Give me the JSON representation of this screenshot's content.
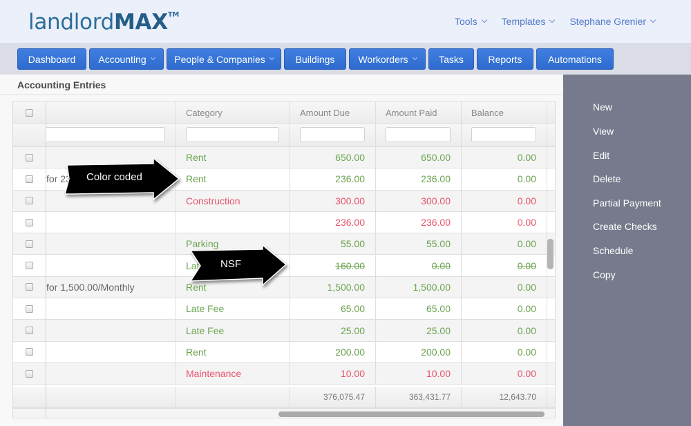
{
  "app": {
    "logo_light": "landlord",
    "logo_bold": "MAX",
    "logo_tm": "TM"
  },
  "topmenu": [
    {
      "label": "Tools"
    },
    {
      "label": "Templates"
    },
    {
      "label": "Stephane Grenier"
    }
  ],
  "nav": [
    {
      "label": "Dashboard",
      "dropdown": false
    },
    {
      "label": "Accounting",
      "dropdown": true
    },
    {
      "label": "People & Companies",
      "dropdown": true
    },
    {
      "label": "Buildings",
      "dropdown": false
    },
    {
      "label": "Workorders",
      "dropdown": true
    },
    {
      "label": "Tasks",
      "dropdown": false
    },
    {
      "label": "Reports",
      "dropdown": false
    },
    {
      "label": "Automations",
      "dropdown": false
    }
  ],
  "section": {
    "title": "Accounting Entries"
  },
  "grid": {
    "columns": [
      "",
      "Category",
      "Amount Due",
      "Amount Paid",
      "Balance"
    ],
    "filters": {
      "description": "",
      "category": "",
      "amount_due": "",
      "amount_paid": "",
      "balance": ""
    },
    "rows": [
      {
        "description": "",
        "category": "Rent",
        "due": "650.00",
        "paid": "650.00",
        "balance": "0.00",
        "color": "green",
        "strike": false
      },
      {
        "description": "for 236.",
        "category": "Rent",
        "due": "236.00",
        "paid": "236.00",
        "balance": "0.00",
        "color": "green",
        "strike": false
      },
      {
        "description": "",
        "category": "Construction",
        "due": "300.00",
        "paid": "300.00",
        "balance": "0.00",
        "color": "red",
        "strike": false
      },
      {
        "description": "",
        "category": "",
        "due": "236.00",
        "paid": "236.00",
        "balance": "0.00",
        "color": "red",
        "strike": false
      },
      {
        "description": "",
        "category": "Parking",
        "due": "55.00",
        "paid": "55.00",
        "balance": "0.00",
        "color": "green",
        "strike": false
      },
      {
        "description": "",
        "category": "Late Fee",
        "due": "160.00",
        "paid": "0.00",
        "balance": "0.00",
        "color": "green",
        "strike": true
      },
      {
        "description": "for 1,500.00/Monthly",
        "category": "Rent",
        "due": "1,500.00",
        "paid": "1,500.00",
        "balance": "0.00",
        "color": "green",
        "strike": false
      },
      {
        "description": "",
        "category": "Late Fee",
        "due": "65.00",
        "paid": "65.00",
        "balance": "0.00",
        "color": "green",
        "strike": false
      },
      {
        "description": "",
        "category": "Late Fee",
        "due": "25.00",
        "paid": "25.00",
        "balance": "0.00",
        "color": "green",
        "strike": false
      },
      {
        "description": "",
        "category": "Rent",
        "due": "200.00",
        "paid": "200.00",
        "balance": "0.00",
        "color": "green",
        "strike": false
      },
      {
        "description": "",
        "category": "Maintenance",
        "due": "10.00",
        "paid": "10.00",
        "balance": "0.00",
        "color": "red",
        "strike": false
      }
    ],
    "totals": {
      "due": "376,075.47",
      "paid": "363,431.77",
      "balance": "12,643.70"
    }
  },
  "sidepanel": [
    {
      "label": "New"
    },
    {
      "label": "View"
    },
    {
      "label": "Edit"
    },
    {
      "label": "Delete"
    },
    {
      "label": "Partial Payment"
    },
    {
      "label": "Create Checks"
    },
    {
      "label": "Schedule"
    },
    {
      "label": "Copy"
    }
  ],
  "annotations": [
    {
      "text": "Color coded"
    },
    {
      "text": "NSF"
    }
  ],
  "colors": {
    "income": "#6aa44f",
    "expense": "#e8546a",
    "nav_button": "#3574d8",
    "side_panel": "#767a8c"
  }
}
